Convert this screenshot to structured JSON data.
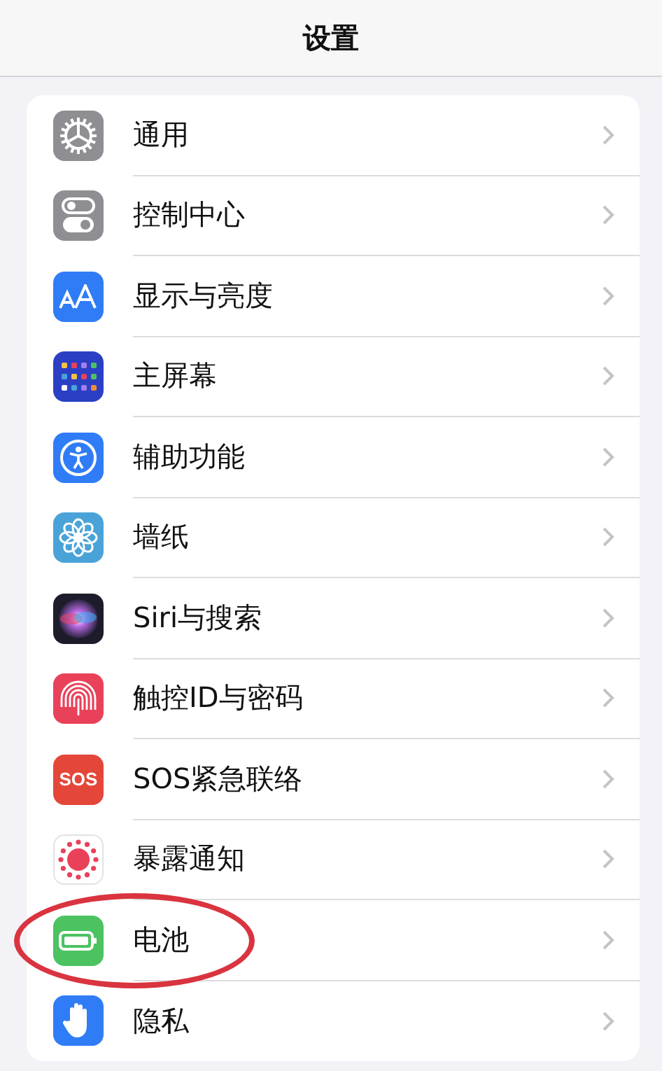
{
  "header": {
    "title": "设置"
  },
  "rows": [
    {
      "label": "通用",
      "kind": "gear",
      "color": "#8e8e93",
      "highlighted": false
    },
    {
      "label": "控制中心",
      "kind": "toggles",
      "color": "#8e8e93",
      "highlighted": false
    },
    {
      "label": "显示与亮度",
      "kind": "text-size",
      "color": "#2f7cf6",
      "highlighted": false
    },
    {
      "label": "主屏幕",
      "kind": "grid",
      "color": "#2b3fc4",
      "highlighted": false
    },
    {
      "label": "辅助功能",
      "kind": "accessibility",
      "color": "#2f7cf6",
      "highlighted": false
    },
    {
      "label": "墙纸",
      "kind": "flower",
      "color": "#4aa3d8",
      "highlighted": false
    },
    {
      "label": "Siri与搜索",
      "kind": "siri",
      "color": "#1c1c2a",
      "highlighted": false
    },
    {
      "label": "触控ID与密码",
      "kind": "fingerprint",
      "color": "#e9415a",
      "highlighted": false
    },
    {
      "label": "SOS紧急联络",
      "kind": "sos",
      "color": "#e5463a",
      "icon_text": "SOS",
      "highlighted": false
    },
    {
      "label": "暴露通知",
      "kind": "exposure",
      "color": "#ffffff",
      "highlighted": false
    },
    {
      "label": "电池",
      "kind": "battery",
      "color": "#4cc261",
      "highlighted": true
    },
    {
      "label": "隐私",
      "kind": "hand",
      "color": "#2f7cf6",
      "highlighted": false
    }
  ]
}
